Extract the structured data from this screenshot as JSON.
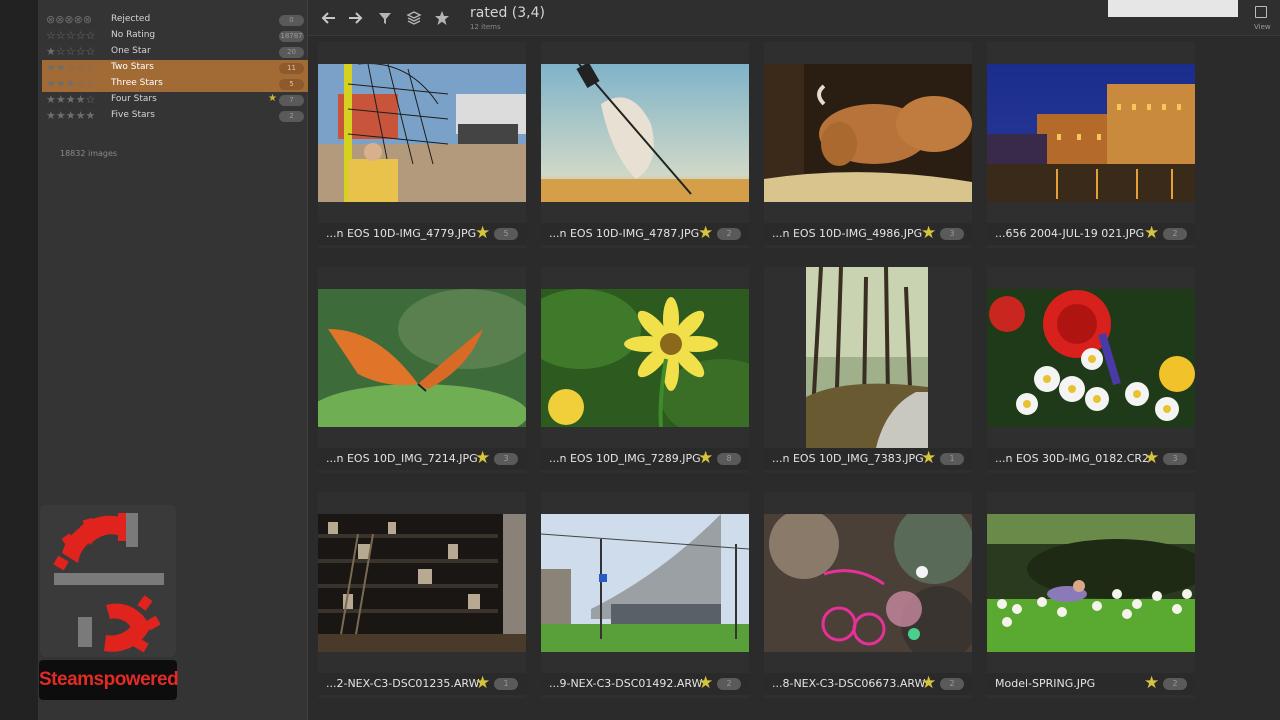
{
  "sidebar": {
    "ratings": [
      {
        "label": "Rejected",
        "stars": "⊗⊗⊗⊗⊗",
        "filled": 0,
        "count": "0",
        "highlighted": false
      },
      {
        "label": "No Rating",
        "stars": "☆☆☆☆☆",
        "filled": 0,
        "count": "18787",
        "highlighted": false
      },
      {
        "label": "One Star",
        "stars": "★☆☆☆☆",
        "filled": 1,
        "count": "20",
        "highlighted": false
      },
      {
        "label": "Two Stars",
        "stars": "★★☆☆☆",
        "filled": 2,
        "count": "11",
        "highlighted": true
      },
      {
        "label": "Three Stars",
        "stars": "★★★☆☆",
        "filled": 3,
        "count": "5",
        "highlighted": true
      },
      {
        "label": "Four Stars",
        "stars": "★★★★☆",
        "filled": 4,
        "count": "7",
        "highlighted": false
      },
      {
        "label": "Five Stars",
        "stars": "★★★★★",
        "filled": 5,
        "count": "2",
        "highlighted": false
      }
    ],
    "total_images": "18832 images"
  },
  "toolbar": {
    "title": "rated  (3,4)",
    "subtitle": "12 items",
    "view_label": "View"
  },
  "watermark": {
    "label": "Steamspowered"
  },
  "grid": [
    {
      "filename": "...n EOS 10D-IMG_4779.JPG",
      "rating": "5",
      "scene": "volleyball"
    },
    {
      "filename": "...n EOS 10D-IMG_4787.JPG",
      "rating": "2",
      "scene": "ball-sky"
    },
    {
      "filename": "...n EOS 10D-IMG_4986.JPG",
      "rating": "3",
      "scene": "deer"
    },
    {
      "filename": "...656 2004-JUL-19 021.JPG",
      "rating": "2",
      "scene": "night-city"
    },
    {
      "filename": "...n EOS 10D_IMG_7214.JPG",
      "rating": "3",
      "scene": "butterfly"
    },
    {
      "filename": "...n EOS 10D_IMG_7289.JPG",
      "rating": "8",
      "scene": "yellow-flower"
    },
    {
      "filename": "...n EOS 10D_IMG_7383.JPG",
      "rating": "1",
      "scene": "forest"
    },
    {
      "filename": "...n EOS 30D-IMG_0182.CR2",
      "rating": "3",
      "scene": "bouquet"
    },
    {
      "filename": "...2-NEX-C3-DSC01235.ARW",
      "rating": "1",
      "scene": "bookshelf"
    },
    {
      "filename": "...9-NEX-C3-DSC01492.ARW",
      "rating": "2",
      "scene": "station"
    },
    {
      "filename": "...8-NEX-C3-DSC06673.ARW",
      "rating": "2",
      "scene": "bokeh"
    },
    {
      "filename": "Model-SPRING.JPG",
      "rating": "2",
      "scene": "daffodils"
    }
  ]
}
